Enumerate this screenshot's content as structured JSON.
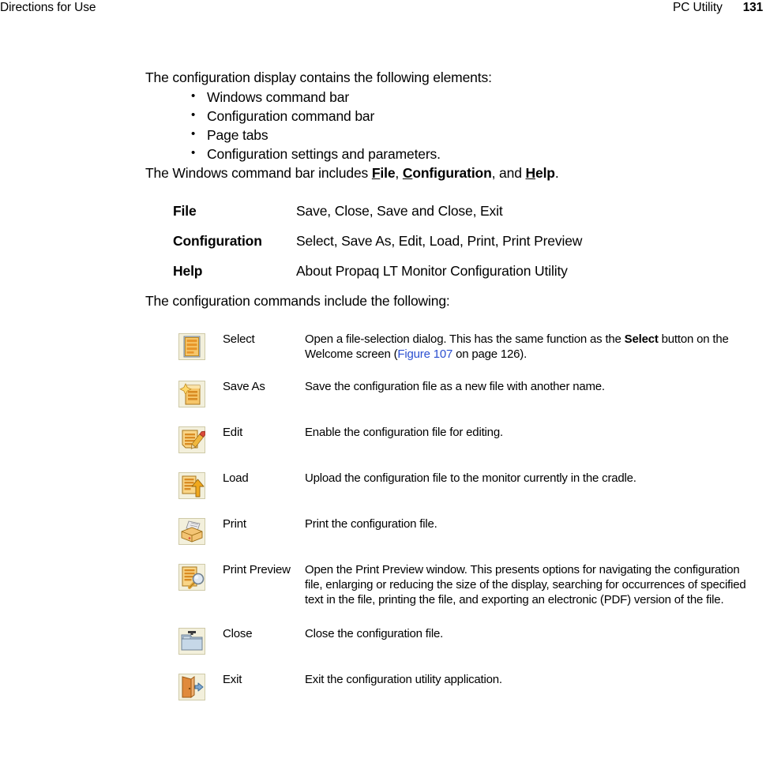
{
  "header": {
    "left": "Directions for Use",
    "document": "PC Utility",
    "page_number": "131"
  },
  "body": {
    "intro_elements": "The configuration display contains the following elements:",
    "bullets": [
      "Windows command bar",
      "Configuration command bar",
      "Page tabs",
      "Configuration settings and parameters."
    ],
    "windows_bar_sentence": {
      "prefix": "The Windows command bar includes ",
      "item1_mnemonic": "F",
      "item1_rest": "ile",
      "sep1": ", ",
      "item2_mnemonic": "C",
      "item2_rest": "onfiguration",
      "sep2": ", and ",
      "item3_mnemonic": "H",
      "item3_rest": "elp",
      "suffix": "."
    },
    "intro_commands": "The configuration commands include the following:"
  },
  "menu_table": {
    "rows": [
      {
        "term": "File",
        "value": "Save, Close, Save and Close, Exit"
      },
      {
        "term": "Configuration",
        "value": "Select, Save As, Edit, Load, Print, Print Preview"
      },
      {
        "term": "Help",
        "value": "About Propaq LT Monitor Configuration Utility"
      }
    ]
  },
  "command_table": {
    "rows": [
      {
        "icon": "select-document-icon",
        "name": "Select",
        "desc_part1": "Open a file-selection dialog. This has the same function as the ",
        "desc_bold": "Select",
        "desc_part2": " button on the Welcome screen (",
        "desc_link": "Figure 107",
        "desc_part3": " on page 126)."
      },
      {
        "icon": "save-as-document-icon",
        "name": "Save As",
        "desc_part1": "Save the configuration file as a new file with another name."
      },
      {
        "icon": "edit-pencil-document-icon",
        "name": "Edit",
        "desc_part1": "Enable the configuration file for editing."
      },
      {
        "icon": "load-upload-arrow-icon",
        "name": "Load",
        "desc_part1": "Upload the configuration file to the monitor currently in the cradle."
      },
      {
        "icon": "printer-icon",
        "name": "Print",
        "desc_part1": "Print the configuration file."
      },
      {
        "icon": "print-preview-magnifier-icon",
        "name": "Print Preview",
        "desc_part1": "Open the Print Preview window. This presents options for navigating the configuration file, enlarging or reducing the size of the display, searching for occurrences of specified text in the file, printing the file, and exporting an electronic (PDF) version of the file."
      },
      {
        "icon": "close-folder-icon",
        "name": "Close",
        "desc_part1": "Close the configuration file."
      },
      {
        "icon": "exit-door-icon",
        "name": "Exit",
        "desc_part1": "Exit the configuration utility application."
      }
    ]
  },
  "colors": {
    "link": "#2b4fd0",
    "icon_gold": "#e8a33d",
    "icon_gold_light": "#f7d98a",
    "icon_border": "#8a6d2a",
    "icon_bg": "#f3f0dc",
    "folder_blue": "#aec3d8",
    "door_orange": "#e08a3c",
    "arrow_blue": "#5d8fc4"
  }
}
